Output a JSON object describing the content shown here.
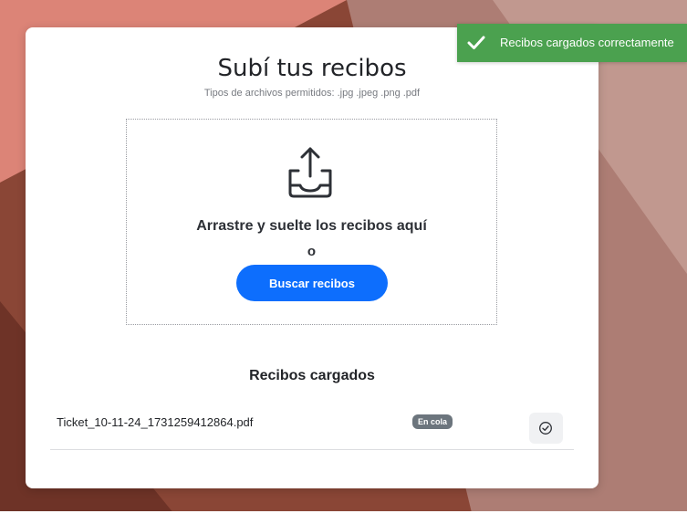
{
  "upload": {
    "title": "Subí tus recibos",
    "subtitle": "Tipos de archivos permitidos: .jpg .jpeg .png .pdf",
    "drop_text": "Arrastre y suelte los recibos aquí",
    "or_text": "o",
    "browse_label": "Buscar recibos"
  },
  "uploaded": {
    "title": "Recibos cargados",
    "files": [
      {
        "name": "Ticket_10-11-24_1731259412864.pdf",
        "status": "En cola"
      }
    ]
  },
  "toast": {
    "message": "Recibos cargados correctamente"
  },
  "colors": {
    "primary": "#0d6efd",
    "success": "#4ba14f",
    "badge": "#6c757d"
  },
  "icons": {
    "upload": "tray-arrow-up-icon",
    "toast": "check-icon",
    "confirm": "check-circle-icon"
  }
}
